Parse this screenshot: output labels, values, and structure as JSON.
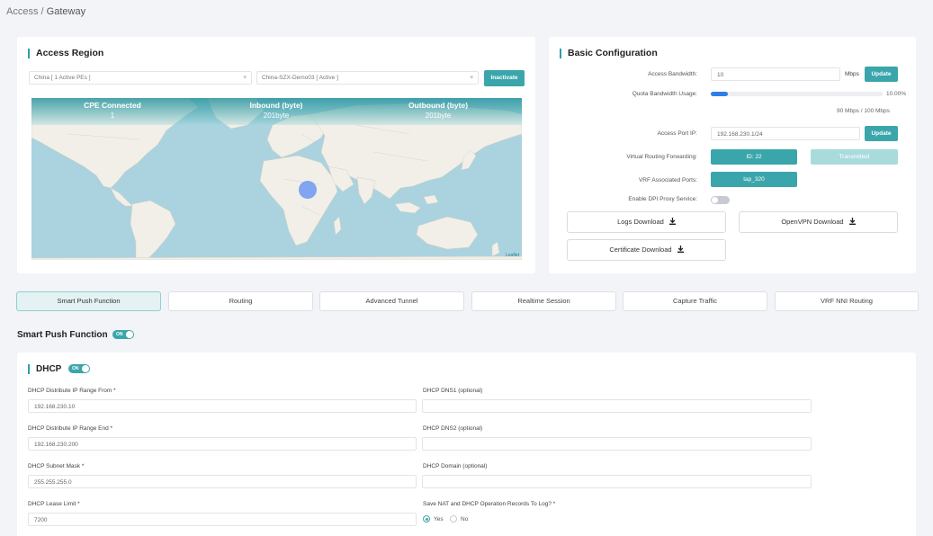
{
  "breadcrumb": {
    "root": "Access",
    "separator": "/",
    "current": "Gateway"
  },
  "access_region": {
    "title": "Access Region",
    "region_select": "China [ 1 Active PEs ]",
    "pe_select": "China-SZX-Demo03 [ Active ]",
    "inactivate_label": "Inactivate",
    "stats": [
      {
        "label": "CPE Connected",
        "value": "1"
      },
      {
        "label": "Inbound (byte)",
        "value": "201byte"
      },
      {
        "label": "Outbound (byte)",
        "value": "201byte"
      }
    ],
    "map_attribution": "Leaflet"
  },
  "basic_config": {
    "title": "Basic Configuration",
    "bandwidth_label": "Access Bandwidth:",
    "bandwidth_value": "10",
    "bandwidth_unit": "Mbps",
    "update_label": "Update",
    "quota_label": "Quota Bandwidth Usage:",
    "quota_percent_text": "10.00%",
    "quota_fraction": 0.1,
    "quota_detail": "90 Mbps / 100 Mbps",
    "port_ip_label": "Access Port IP:",
    "port_ip_value": "192.168.230.1/24",
    "port_update_label": "Update",
    "vrf_label": "Virtual Routing Forwarding:",
    "vrf_id": "ID: 22",
    "vrf_status": "Transmitted",
    "vrf_ports_label": "VRF Associated Ports:",
    "vrf_port": "tap_320",
    "dpi_label": "Enable DPI Proxy Service:",
    "dpi_enabled": false,
    "logs_download": "Logs Download",
    "openvpn_download": "OpenVPN Download",
    "cert_download": "Certificate Download"
  },
  "tabs": [
    {
      "label": "Smart Push Function",
      "active": true
    },
    {
      "label": "Routing",
      "active": false
    },
    {
      "label": "Advanced Tunnel",
      "active": false
    },
    {
      "label": "Realtime Session",
      "active": false
    },
    {
      "label": "Capture Traffic",
      "active": false
    },
    {
      "label": "VRF NNI Routing",
      "active": false
    }
  ],
  "smart_push": {
    "title": "Smart Push Function",
    "toggle_text": "ON"
  },
  "dhcp": {
    "title": "DHCP",
    "toggle_text": "ON",
    "range_from_label": "DHCP Distribute IP Range From *",
    "range_from_value": "192.168.230.10",
    "range_end_label": "DHCP Distribute IP Range End *",
    "range_end_value": "192.168.230.200",
    "subnet_label": "DHCP Subnet Mask *",
    "subnet_value": "255.255.255.0",
    "lease_label": "DHCP Lease Limit *",
    "lease_value": "7200",
    "dns1_label": "DHCP DNS1 (optional)",
    "dns1_value": "",
    "dns2_label": "DHCP DNS2 (optional)",
    "dns2_value": "",
    "domain_label": "DHCP Domain (optional)",
    "domain_value": "",
    "log_label": "Save NAT and DHCP Operation Records To Log? *",
    "yes_label": "Yes",
    "no_label": "No",
    "log_selected": "Yes"
  },
  "colors": {
    "accent": "#3aa6ab",
    "progress": "#2f7ee8",
    "ocean": "#aad3df",
    "land": "#f2efe9"
  }
}
